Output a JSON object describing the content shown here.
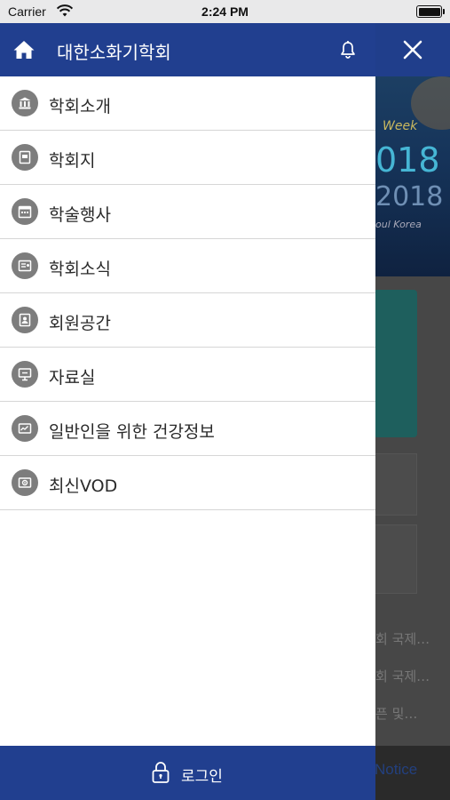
{
  "status_bar": {
    "carrier": "Carrier",
    "time": "2:24 PM",
    "icons": [
      "wifi-icon",
      "battery-icon"
    ]
  },
  "drawer": {
    "title": "대한소화기학회",
    "header_icons": [
      "home-icon",
      "bell-icon"
    ],
    "menu": [
      {
        "label": "학회소개",
        "icon": "building-icon"
      },
      {
        "label": "학회지",
        "icon": "journal-icon"
      },
      {
        "label": "학술행사",
        "icon": "calendar-icon"
      },
      {
        "label": "학회소식",
        "icon": "news-icon"
      },
      {
        "label": "회원공간",
        "icon": "member-icon"
      },
      {
        "label": "자료실",
        "icon": "archive-icon"
      },
      {
        "label": "일반인을 위한 건강정보",
        "icon": "health-info-icon"
      },
      {
        "label": "최신VOD",
        "icon": "video-icon"
      }
    ],
    "footer": {
      "login_label": "로그인",
      "icon": "lock-icon"
    }
  },
  "background": {
    "close_icon": "close-icon",
    "banner": {
      "line1": "Week",
      "line2": "018",
      "line3": "2018",
      "line4": "oul Korea"
    },
    "list_lines": [
      "회 국제…",
      "회 국제…",
      "픈 및…"
    ],
    "tab_label": "Notice"
  },
  "colors": {
    "header_blue": "#213f8f",
    "icon_gray": "#7d7d7d",
    "divider": "#d6d6d6"
  }
}
